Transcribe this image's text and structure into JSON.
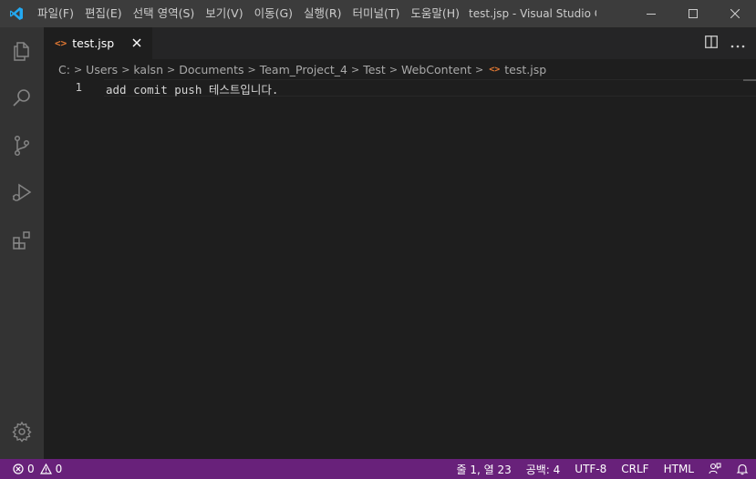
{
  "titlebar": {
    "menu": [
      "파일(F)",
      "편집(E)",
      "선택 영역(S)",
      "보기(V)",
      "이동(G)",
      "실행(R)",
      "터미널(T)",
      "도움말(H)"
    ],
    "window_title": "test.jsp - Visual Studio C..."
  },
  "tab": {
    "icon": "<>",
    "label": "test.jsp"
  },
  "breadcrumb": {
    "items": [
      "C:",
      "Users",
      "kalsn",
      "Documents",
      "Team_Project_4",
      "Test",
      "WebContent"
    ],
    "file_icon": "<>",
    "file": "test.jsp"
  },
  "editor": {
    "line_number": "1",
    "code": "add comit push 테스트입니다."
  },
  "statusbar": {
    "errors": "0",
    "warnings": "0",
    "position": "줄 1, 열 23",
    "spaces": "공백: 4",
    "encoding": "UTF-8",
    "eol": "CRLF",
    "language": "HTML"
  },
  "colors": {
    "statusbar_bg": "#68217a",
    "accent_file_icon": "#e37933",
    "vscode_blue": "#23a9f2"
  }
}
